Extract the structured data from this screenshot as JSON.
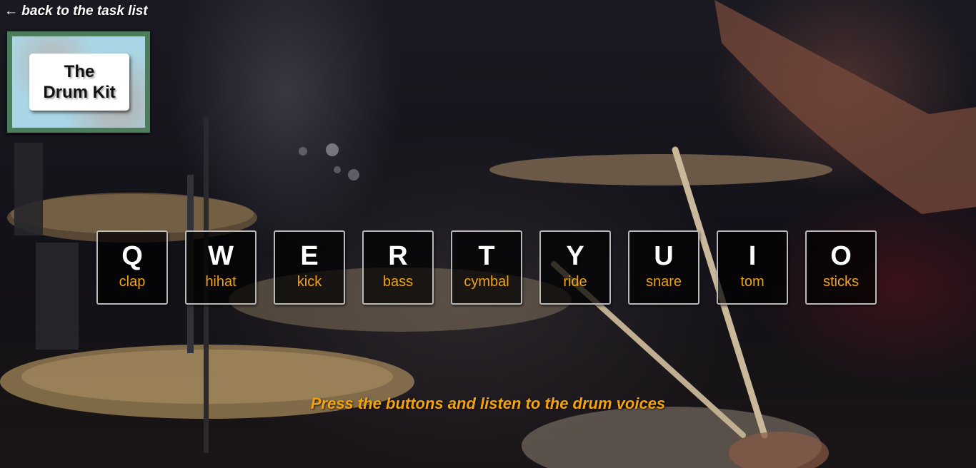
{
  "nav": {
    "back_label": "← back to the task list"
  },
  "logo": {
    "line1": "The",
    "line2": "Drum Kit"
  },
  "keys": [
    {
      "letter": "Q",
      "sound": "clap"
    },
    {
      "letter": "W",
      "sound": "hihat"
    },
    {
      "letter": "E",
      "sound": "kick"
    },
    {
      "letter": "R",
      "sound": "bass"
    },
    {
      "letter": "T",
      "sound": "cymbal"
    },
    {
      "letter": "Y",
      "sound": "ride"
    },
    {
      "letter": "U",
      "sound": "snare"
    },
    {
      "letter": "I",
      "sound": "tom"
    },
    {
      "letter": "O",
      "sound": "sticks"
    }
  ],
  "hint": "Press the buttons and listen to the drum voices",
  "colors": {
    "accent": "#f0a310",
    "logo_frame": "#4c7e5c",
    "logo_bg": "#a9d6e6"
  }
}
